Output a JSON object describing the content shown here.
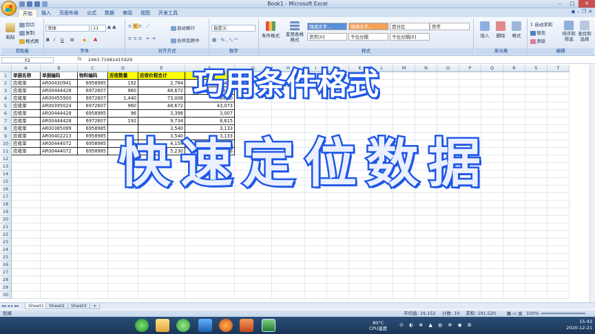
{
  "window": {
    "title": "Book1 - Microsoft Excel"
  },
  "tabs": [
    "开始",
    "插入",
    "页面布局",
    "公式",
    "数据",
    "审阅",
    "视图",
    "开发工具"
  ],
  "active_tab": "开始",
  "ribbon": {
    "clipboard": {
      "paste": "粘贴",
      "cut": "剪切",
      "copy": "复制",
      "format_painter": "格式刷",
      "label": "剪贴板"
    },
    "font": {
      "name": "宋体",
      "size": "11",
      "label": "字体"
    },
    "alignment": {
      "wrap": "自动换行",
      "merge": "合并后居中",
      "label": "对齐方式"
    },
    "number": {
      "format": "自定义",
      "label": "数字"
    },
    "styles": {
      "conditional": "条件格式",
      "table": "套用表格格式",
      "label": "样式",
      "cells": [
        "强调文字...",
        "强调文字...",
        "百分比",
        "货币",
        "货币[0]",
        "千位分隔",
        "千位分隔[0]"
      ]
    },
    "cells": {
      "insert": "插入",
      "delete": "删除",
      "format": "格式",
      "label": "单元格"
    },
    "editing": {
      "autosum": "自动求和",
      "fill": "填充",
      "clear": "清除",
      "sort": "排序和筛选",
      "find": "查找和选择",
      "label": "编辑"
    }
  },
  "formula_bar": {
    "name_box": "F2",
    "fx": "fx",
    "value": "2463.71681415929"
  },
  "columns": [
    "A",
    "B",
    "C",
    "D",
    "E",
    "F",
    "G",
    "H",
    "I",
    "J",
    "K",
    "L",
    "M",
    "N",
    "O",
    "P",
    "Q",
    "R",
    "S",
    "T"
  ],
  "rows": [
    [
      "单据名称",
      "单据编码",
      "物料编码",
      "应收数量",
      "应收价税合计",
      ""
    ],
    [
      "应收单",
      "AR00430941",
      "6958985",
      "192",
      "2,784",
      "2,463"
    ],
    [
      "应收单",
      "AR00444428",
      "6972607",
      "960",
      "48,672",
      "43,07"
    ],
    [
      "应收单",
      "AR00455900",
      "6972607",
      "1,440",
      "73,008",
      "64,60"
    ],
    [
      "应收单",
      "AR00395024",
      "6972607",
      "960",
      "48,672",
      "43,073"
    ],
    [
      "应收单",
      "AR00444428",
      "6958985",
      "96",
      "3,398",
      "3,007"
    ],
    [
      "应收单",
      "AR00444428",
      "6972607",
      "192",
      "9,734",
      "8,615"
    ],
    [
      "应收单",
      "AR00385099",
      "6958985",
      "",
      "3,540",
      "3,133"
    ],
    [
      "应收单",
      "AR00402213",
      "6958985",
      "",
      "3,540",
      "3,133"
    ],
    [
      "应收单",
      "AR00444072",
      "6958985",
      "",
      "4,154",
      "3,676"
    ],
    [
      "应收单",
      "AR00444072",
      "6958985",
      "",
      "5,230",
      "4,628"
    ]
  ],
  "sheets": [
    "Sheet1",
    "Sheet2",
    "Sheet3"
  ],
  "status": {
    "mode": "就绪",
    "avg": "平均值: 19,152",
    "count": "计数: 10",
    "sum": "求和: 191,520",
    "zoom": "100%"
  },
  "taskbar": {
    "temp": "80°C",
    "temp_label": "CPU温度",
    "time": "15:43",
    "date": "2020-12-21"
  },
  "overlay": {
    "line1": "巧用条件格式",
    "line2": "快速定位数据"
  }
}
